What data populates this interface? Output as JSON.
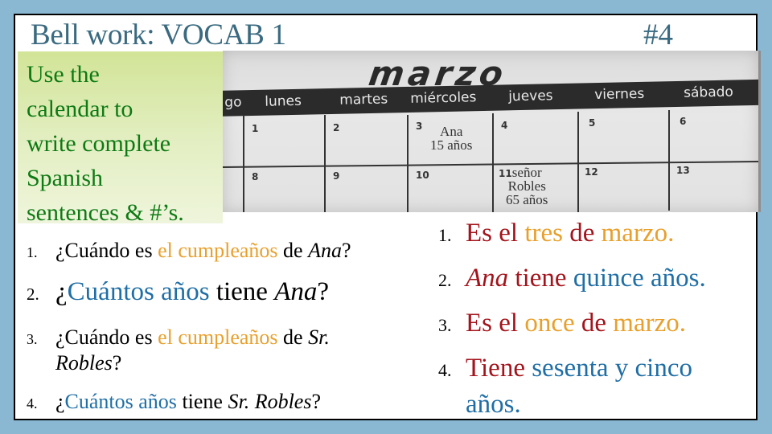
{
  "header": {
    "title": "Bell work: VOCAB 1",
    "slide_number": "#4"
  },
  "instructions": "Use the\ncalendar to\nwrite complete\nSpanish\nsentences & #’s.",
  "calendar": {
    "month": "marzo",
    "days": [
      "go",
      "lunes",
      "martes",
      "miércoles",
      "jueves",
      "viernes",
      "sábado"
    ],
    "cells": [
      {
        "num": "1",
        "note": ""
      },
      {
        "num": "2",
        "note": ""
      },
      {
        "num": "3",
        "note": "Ana\n15 años"
      },
      {
        "num": "4",
        "note": ""
      },
      {
        "num": "5",
        "note": ""
      },
      {
        "num": "6",
        "note": ""
      },
      {
        "num": "8",
        "note": ""
      },
      {
        "num": "9",
        "note": ""
      },
      {
        "num": "10",
        "note": ""
      },
      {
        "num": "11",
        "note": "señor\nRobles\n65 años"
      },
      {
        "num": "12",
        "note": ""
      },
      {
        "num": "13",
        "note": ""
      }
    ]
  },
  "questions": [
    {
      "num": "1.",
      "parts": [
        "¿Cuándo es ",
        "el cumpleaños",
        " de ",
        "Ana",
        "?"
      ]
    },
    {
      "num": "2.",
      "parts": [
        "¿",
        "Cuántos años",
        " tiene ",
        "Ana",
        "?"
      ]
    },
    {
      "num": "3.",
      "parts": [
        "¿Cuándo es ",
        "el cumpleaños",
        " de ",
        "Sr.",
        "Robles",
        "?"
      ]
    },
    {
      "num": "4.",
      "parts": [
        "¿",
        "Cuántos años",
        " tiene ",
        "Sr. Robles",
        "?"
      ]
    }
  ],
  "answers": [
    {
      "num": "1.",
      "parts": [
        "Es el ",
        "tres",
        " de ",
        "marzo."
      ]
    },
    {
      "num": "2.",
      "parts": [
        "Ana",
        " tiene ",
        "quince años."
      ]
    },
    {
      "num": "3.",
      "parts": [
        "Es el ",
        "once",
        " de ",
        "marzo."
      ]
    },
    {
      "num": "4.",
      "parts": [
        "Tiene ",
        "sesenta y cinco",
        "años."
      ]
    }
  ],
  "colors": {
    "background": "#8ab8d3",
    "title": "#3a6a80",
    "instructions": "#0e7a14",
    "highlight_orange": "#e8a02c",
    "highlight_blue": "#1f6ea5",
    "answer_red": "#a3141c"
  }
}
